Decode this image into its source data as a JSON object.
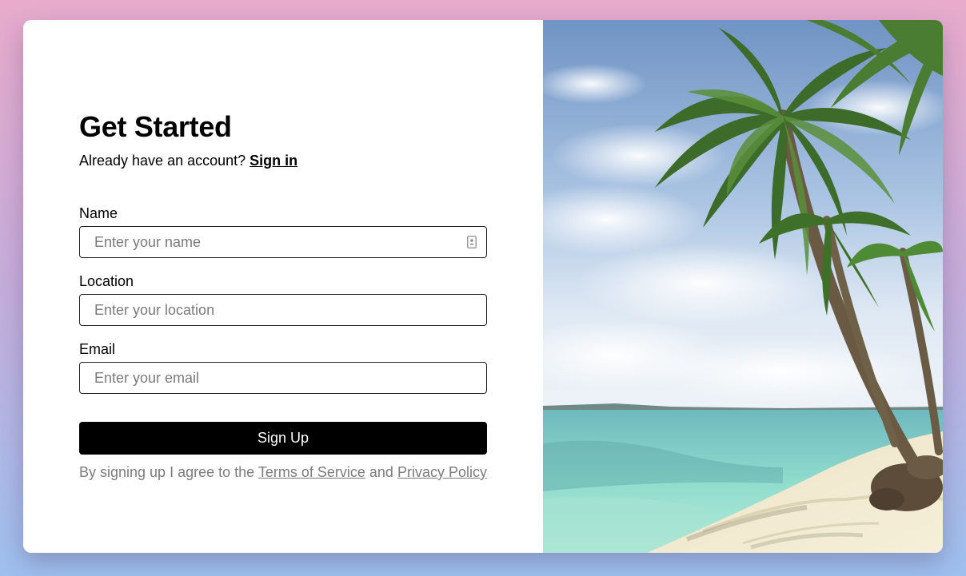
{
  "form": {
    "title": "Get Started",
    "account_prompt": "Already have an account?",
    "signin_link": "Sign in",
    "fields": [
      {
        "label": "Name",
        "placeholder": "Enter your name",
        "value": ""
      },
      {
        "label": "Location",
        "placeholder": "Enter your location",
        "value": ""
      },
      {
        "label": "Email",
        "placeholder": "Enter your email",
        "value": ""
      }
    ],
    "submit_label": "Sign Up",
    "terms_prefix": "By signing up I agree to the",
    "terms_link": "Terms of Service",
    "terms_and": "and",
    "privacy_link": "Privacy Policy"
  },
  "hero_image": {
    "icon": "beach-palm-tree-photo"
  },
  "colors": {
    "button_bg": "#000000",
    "muted_text": "#7b7b7b"
  }
}
